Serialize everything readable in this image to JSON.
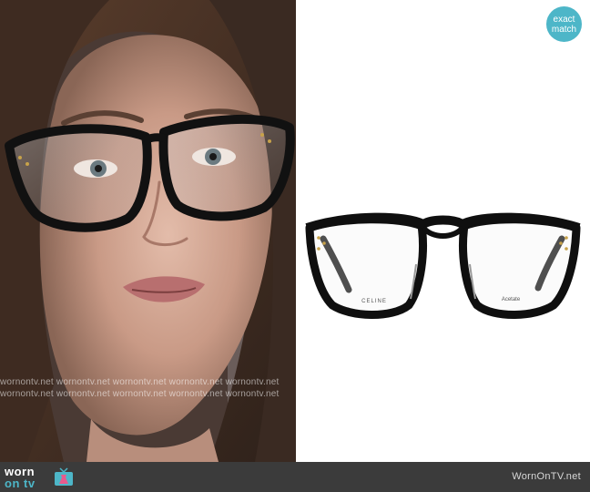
{
  "badge": {
    "line1": "exact",
    "line2": "match"
  },
  "watermark": {
    "row1": "wornontv.net  wornontv.net  wornontv.net  wornontv.net  wornontv.net",
    "row2": "wornontv.net  wornontv.net  wornontv.net  wornontv.net  wornontv.net"
  },
  "product": {
    "temple_left_text": "CELINE",
    "temple_right_text": "Acetate"
  },
  "footer": {
    "logo_top": "worn",
    "logo_bottom": "on tv",
    "site_name": "WornOnTV.net"
  },
  "colors": {
    "accent": "#4db6c8",
    "footer_bg": "#3b3b3b"
  }
}
